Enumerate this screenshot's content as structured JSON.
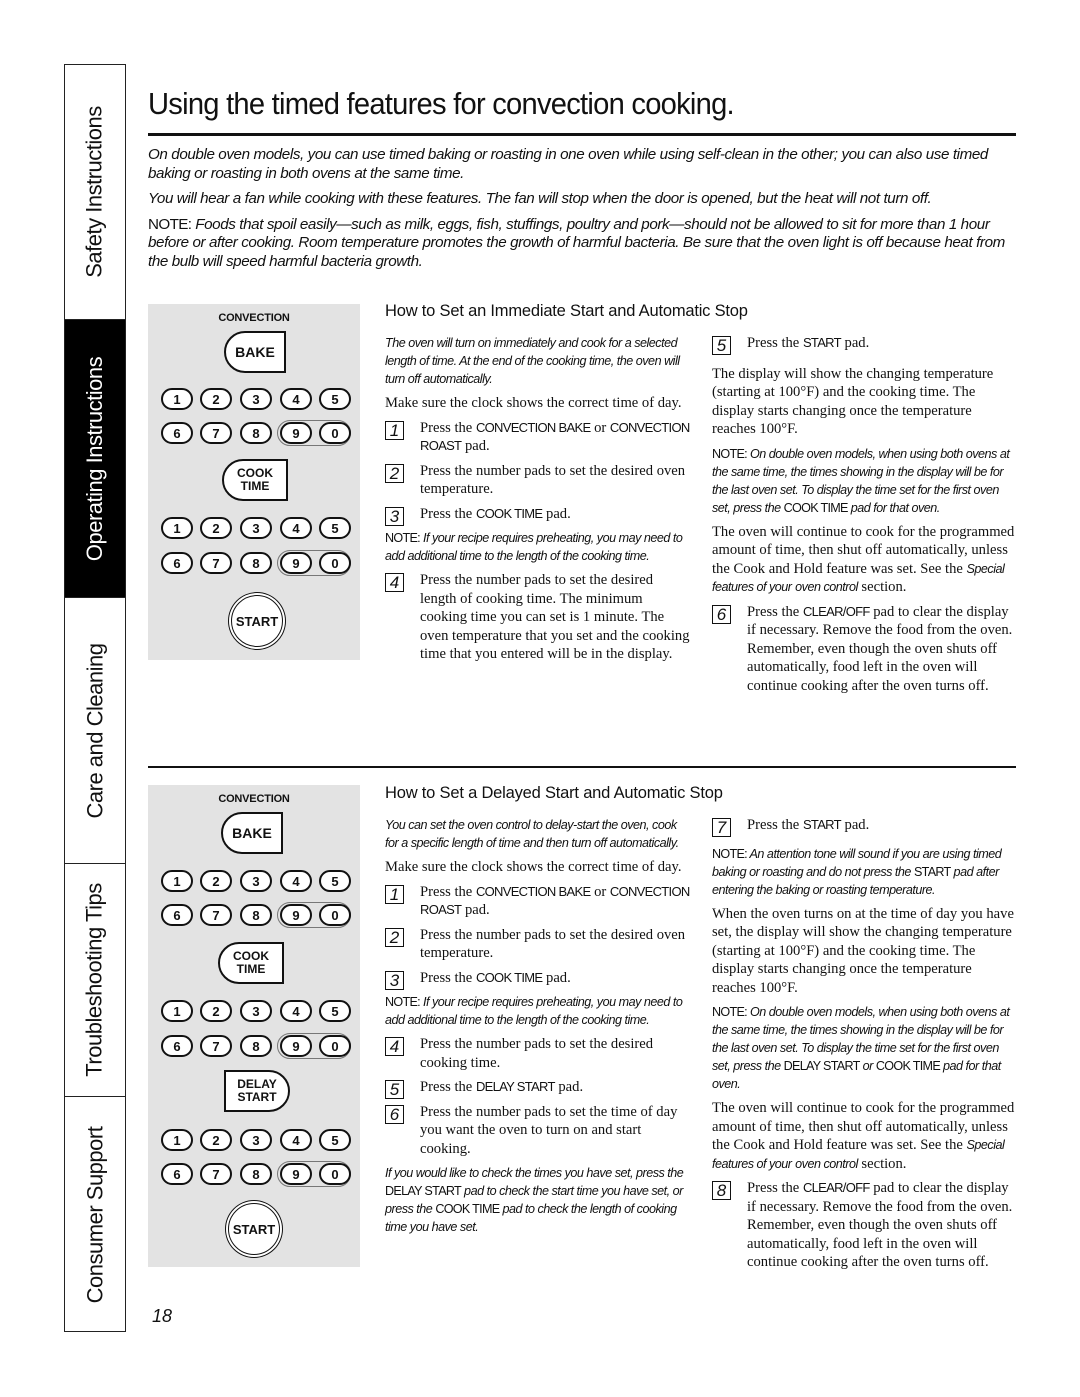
{
  "side_tabs": [
    {
      "label": "Safety Instructions",
      "active": false
    },
    {
      "label": "Operating Instructions",
      "active": true
    },
    {
      "label": "Care and Cleaning",
      "active": false
    },
    {
      "label": "Troubleshooting Tips",
      "active": false
    },
    {
      "label": "Consumer Support",
      "active": false
    }
  ],
  "page": {
    "title": "Using the timed features for convection cooking.",
    "page_number": "18"
  },
  "intro": {
    "p1": "On double oven models, you can use timed baking or roasting in one oven while using self-clean in the other; you can also use timed baking or roasting in both ovens at the same time.",
    "p2": "You will hear a fan while cooking with these features. The fan will stop when the door is opened, but the heat will not turn off.",
    "note_label": "NOTE:",
    "note_text": "Foods that spoil easily—such as milk, eggs, fish, stuffings, poultry and pork—should not be allowed to sit for more than 1 hour before or after cooking. Room temperature promotes the growth of harmful bacteria. Be sure that the oven light is off because heat from the bulb will speed harmful bacteria growth."
  },
  "panel1": {
    "convection_label": "CONVECTION",
    "bake": "BAKE",
    "cook_time_1": "COOK",
    "cook_time_2": "TIME",
    "start": "START",
    "digits_row1": [
      "1",
      "2",
      "3",
      "4",
      "5"
    ],
    "digits_row2": [
      "6",
      "7",
      "8",
      "9",
      "0"
    ]
  },
  "panel2": {
    "convection_label": "CONVECTION",
    "bake": "BAKE",
    "cook_time_1": "COOK",
    "cook_time_2": "TIME",
    "delay_1": "DELAY",
    "delay_2": "START",
    "start": "START",
    "digits_row1": [
      "1",
      "2",
      "3",
      "4",
      "5"
    ],
    "digits_row2": [
      "6",
      "7",
      "8",
      "9",
      "0"
    ]
  },
  "immediate": {
    "heading": "How to Set an Immediate Start and Automatic Stop",
    "desc": "The oven will turn on immediately and cook for a selected length of time. At the end of the cooking time, the oven will turn off automatically.",
    "clock": "Make sure the clock shows the correct time of day.",
    "steps": [
      {
        "n": "1",
        "pre": "Press the ",
        "key": "CONVECTION BAKE",
        "mid": " or ",
        "key2": "CONVECTION ROAST",
        "post": " pad."
      },
      {
        "n": "2",
        "text": "Press the number pads to set the desired oven temperature."
      },
      {
        "n": "3",
        "pre": "Press the ",
        "key": "COOK TIME",
        "post": " pad."
      },
      {
        "n": "4",
        "text": "Press the number pads to set the desired length of cooking time. The minimum cooking time you can set is 1 minute. The oven temperature that you set and the cooking time that you entered will be in the display."
      },
      {
        "n": "5",
        "pre": "Press the ",
        "key": "START",
        "post": " pad."
      },
      {
        "n": "6",
        "pre": "Press the ",
        "key": "CLEAR/OFF",
        "post": " pad to clear the display if necessary. Remove the food from the oven. Remember, even though the oven shuts off automatically, food left in the oven will continue cooking after the oven turns off."
      }
    ],
    "note_preheat_label": "NOTE:",
    "note_preheat": "If your recipe requires preheating, you may need to add additional time to the length of the cooking time.",
    "display_text": "The display will show the changing temperature (starting at 100°F) and the cooking time. The display starts changing once the temperature reaches 100°F.",
    "note_double_label": "NOTE:",
    "note_double_pre": "On double oven models, when using both ovens at the same time, the times showing in the display will be for the last oven set. To display the time set for the first oven set, press the ",
    "note_double_key": "COOK TIME",
    "note_double_post": " pad for that oven.",
    "continue_pre": "The oven will continue to cook for the programmed amount of time, then shut off automatically, unless the Cook and Hold feature was set. See the ",
    "continue_italic1": "Special features of your",
    "continue_italic2": "oven control",
    "continue_post": " section."
  },
  "delayed": {
    "heading": "How to Set a Delayed Start and Automatic Stop",
    "desc": "You can set the oven control to delay-start the oven, cook for a specific length of time and then turn off automatically.",
    "clock": "Make sure the clock shows the correct time of day.",
    "steps": [
      {
        "n": "1",
        "pre": "Press the ",
        "key": "CONVECTION BAKE",
        "mid": " or ",
        "key2": "CONVECTION ROAST",
        "post": " pad."
      },
      {
        "n": "2",
        "text": "Press the number pads to set the desired oven temperature."
      },
      {
        "n": "3",
        "pre": "Press the ",
        "key": "COOK TIME",
        "post": " pad."
      },
      {
        "n": "4",
        "text": "Press the number pads to set the desired cooking time."
      },
      {
        "n": "5",
        "pre": "Press the ",
        "key": "DELAY START",
        "post": " pad."
      },
      {
        "n": "6",
        "text": "Press the number pads to set the time of day you want the oven to turn on and start cooking."
      },
      {
        "n": "7",
        "pre": "Press the ",
        "key": "START",
        "post": " pad."
      },
      {
        "n": "8",
        "pre": "Press the ",
        "key": "CLEAR/OFF",
        "post": " pad to clear the display if necessary. Remove the food from the oven. Remember, even though the oven shuts off automatically, food left in the oven will continue cooking after the oven turns off."
      }
    ],
    "note_preheat_label": "NOTE:",
    "note_preheat": "If your recipe requires preheating, you may need to add additional time to the length of the cooking time.",
    "check_pre": "If you would like to check the times you have set, press the ",
    "check_key1": "DELAY START",
    "check_mid": " pad to check the start time you have set, or press the ",
    "check_key2": "COOK TIME",
    "check_post": " pad to check the length of cooking time you have set.",
    "note_tone_label": "NOTE:",
    "note_tone_pre": "An attention tone will sound if you are using timed baking or roasting and do not press the ",
    "note_tone_key": "START",
    "note_tone_post": " pad after entering the baking or roasting temperature.",
    "display_text": "When the oven turns on at the time of day you have set, the display will show the changing temperature (starting at 100°F) and the cooking time. The display starts changing once the temperature reaches 100°F.",
    "note_double_label": "NOTE:",
    "note_double_pre": "On double oven models, when using both ovens at the same time, the times showing in the display will be for the last oven set. To display the time set for the first oven set, press the ",
    "note_double_key1": "DELAY START",
    "note_double_or": " or ",
    "note_double_key2": "COOK TIME",
    "note_double_post": " pad for that oven.",
    "continue_pre": "The oven will continue to cook for the programmed amount of time, then shut off automatically, unless the Cook and Hold feature was set. See the ",
    "continue_italic1": "Special features of your",
    "continue_italic2": "oven control",
    "continue_post": " section."
  }
}
